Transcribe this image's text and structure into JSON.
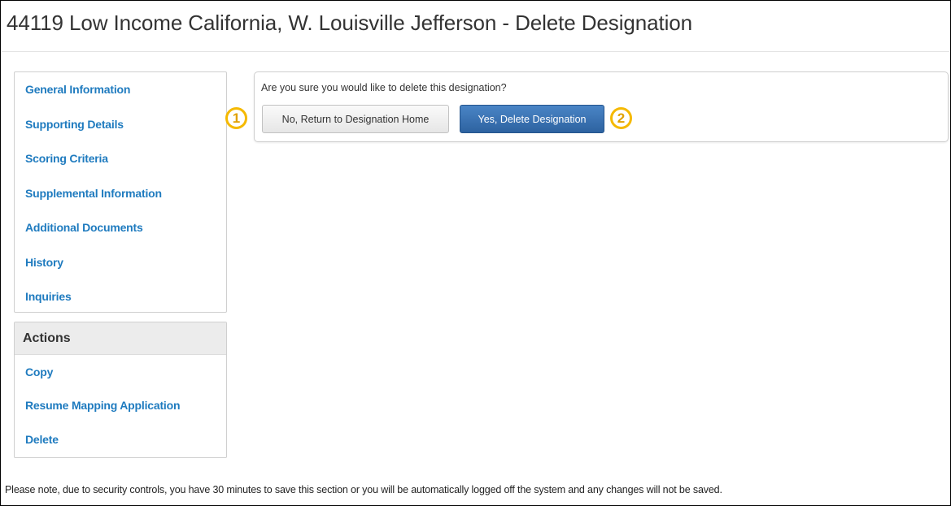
{
  "page": {
    "title": "44119 Low Income California, W. Louisville Jefferson - Delete Designation"
  },
  "sidebar": {
    "nav_items": [
      {
        "label": "General Information"
      },
      {
        "label": "Supporting Details"
      },
      {
        "label": "Scoring Criteria"
      },
      {
        "label": "Supplemental Information"
      },
      {
        "label": "Additional Documents"
      },
      {
        "label": "History"
      },
      {
        "label": "Inquiries"
      }
    ],
    "actions": {
      "title": "Actions",
      "items": [
        {
          "label": "Copy"
        },
        {
          "label": "Resume Mapping Application"
        },
        {
          "label": "Delete"
        }
      ]
    }
  },
  "confirm": {
    "question": "Are you sure you would like to delete this designation?",
    "cancel_label": "No, Return to Designation Home",
    "delete_label": "Yes, Delete Designation"
  },
  "callouts": {
    "first": "1",
    "second": "2",
    "color": "#f5b900"
  },
  "colors": {
    "link": "#1f7bbf",
    "primary_button": "#2d62a0"
  },
  "footer": {
    "note": "Please note, due to security controls, you have 30 minutes to save this section or you will be automatically logged off the system and any changes will not be saved."
  }
}
